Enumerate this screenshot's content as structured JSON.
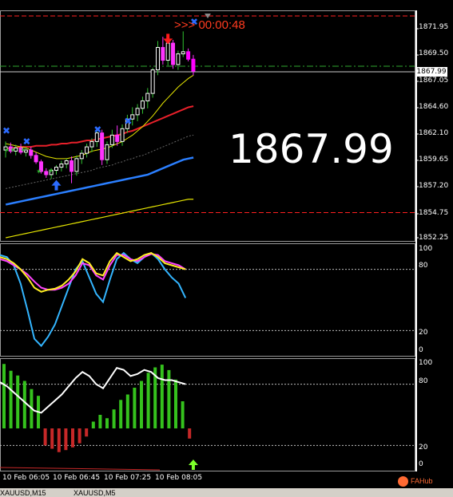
{
  "chart": {
    "symbol_tabs": [
      "XAUUSD,M15",
      "XAUUSD,M5"
    ],
    "current_price": "1867.99",
    "big_price": "1867.99",
    "countdown": ">>> 00:00:48",
    "price_axis": [
      "1871.95",
      "1869.50",
      "1867.05",
      "1864.60",
      "1862.10",
      "1859.65",
      "1857.20",
      "1854.75",
      "1852.25"
    ],
    "stoch_axis": [
      "100",
      "80",
      "20",
      "0"
    ],
    "osc_axis": [
      "100",
      "80",
      "20",
      "0"
    ],
    "time_axis": [
      "10 Feb 06:05",
      "10 Feb 06:45",
      "10 Feb 07:25",
      "10 Feb 08:05"
    ],
    "logo": "FAHub",
    "colors": {
      "bull_candle": "#ffffff",
      "bear_candle": "#ff00ff",
      "red_ma": "#e8202a",
      "blue_ma": "#2b7fff",
      "yellow_ma": "#e6e600",
      "stoch_main": "#ffee22",
      "stoch_signal": "#ff44ff",
      "stoch_cyan": "#33b5ff",
      "hist_pos": "#35c21d",
      "hist_neg": "#c62828",
      "countdown": "#ff3b1f"
    }
  },
  "chart_data": {
    "type": "line",
    "price_ylim": [
      1852.25,
      1871.95
    ],
    "last_price": 1867.99,
    "candles": [
      {
        "o": 1860.6,
        "h": 1861.4,
        "l": 1859.9,
        "c": 1860.9
      },
      {
        "o": 1860.9,
        "h": 1861.3,
        "l": 1860.3,
        "c": 1860.5
      },
      {
        "o": 1860.5,
        "h": 1861.1,
        "l": 1860.1,
        "c": 1860.8
      },
      {
        "o": 1860.8,
        "h": 1861.2,
        "l": 1860.2,
        "c": 1860.4
      },
      {
        "o": 1860.4,
        "h": 1860.9,
        "l": 1860.0,
        "c": 1860.6
      },
      {
        "o": 1860.6,
        "h": 1860.9,
        "l": 1859.8,
        "c": 1860.1
      },
      {
        "o": 1860.1,
        "h": 1860.4,
        "l": 1859.3,
        "c": 1859.5
      },
      {
        "o": 1859.5,
        "h": 1859.7,
        "l": 1858.4,
        "c": 1858.6
      },
      {
        "o": 1858.6,
        "h": 1858.9,
        "l": 1858.0,
        "c": 1858.3
      },
      {
        "o": 1858.3,
        "h": 1858.9,
        "l": 1857.9,
        "c": 1858.7
      },
      {
        "o": 1858.7,
        "h": 1859.2,
        "l": 1858.3,
        "c": 1859.0
      },
      {
        "o": 1859.0,
        "h": 1859.6,
        "l": 1858.6,
        "c": 1859.3
      },
      {
        "o": 1859.3,
        "h": 1859.8,
        "l": 1858.9,
        "c": 1859.6
      },
      {
        "o": 1859.6,
        "h": 1860.0,
        "l": 1857.5,
        "c": 1858.6
      },
      {
        "o": 1858.6,
        "h": 1860.1,
        "l": 1858.2,
        "c": 1859.8
      },
      {
        "o": 1859.8,
        "h": 1860.6,
        "l": 1859.3,
        "c": 1860.3
      },
      {
        "o": 1860.3,
        "h": 1861.2,
        "l": 1859.9,
        "c": 1860.9
      },
      {
        "o": 1860.9,
        "h": 1861.7,
        "l": 1860.4,
        "c": 1861.4
      },
      {
        "o": 1861.4,
        "h": 1862.6,
        "l": 1860.9,
        "c": 1862.2
      },
      {
        "o": 1862.2,
        "h": 1862.5,
        "l": 1859.2,
        "c": 1859.7
      },
      {
        "o": 1859.7,
        "h": 1861.4,
        "l": 1859.3,
        "c": 1861.1
      },
      {
        "o": 1861.1,
        "h": 1862.5,
        "l": 1860.8,
        "c": 1862.0
      },
      {
        "o": 1862.0,
        "h": 1862.9,
        "l": 1861.0,
        "c": 1861.4
      },
      {
        "o": 1861.4,
        "h": 1863.0,
        "l": 1861.0,
        "c": 1862.6
      },
      {
        "o": 1862.6,
        "h": 1863.9,
        "l": 1862.2,
        "c": 1863.5
      },
      {
        "o": 1863.5,
        "h": 1864.6,
        "l": 1862.9,
        "c": 1863.9
      },
      {
        "o": 1863.9,
        "h": 1864.9,
        "l": 1863.3,
        "c": 1864.5
      },
      {
        "o": 1864.5,
        "h": 1865.6,
        "l": 1864.0,
        "c": 1865.2
      },
      {
        "o": 1865.2,
        "h": 1866.4,
        "l": 1864.5,
        "c": 1865.9
      },
      {
        "o": 1865.9,
        "h": 1868.3,
        "l": 1865.5,
        "c": 1868.1
      },
      {
        "o": 1868.1,
        "h": 1870.8,
        "l": 1867.6,
        "c": 1870.2
      },
      {
        "o": 1870.2,
        "h": 1871.2,
        "l": 1868.6,
        "c": 1869.0
      },
      {
        "o": 1869.0,
        "h": 1871.0,
        "l": 1868.5,
        "c": 1870.6
      },
      {
        "o": 1870.6,
        "h": 1870.9,
        "l": 1868.2,
        "c": 1868.6
      },
      {
        "o": 1868.6,
        "h": 1869.9,
        "l": 1868.1,
        "c": 1869.6
      },
      {
        "o": 1869.6,
        "h": 1871.7,
        "l": 1869.3,
        "c": 1869.8
      },
      {
        "o": 1869.8,
        "h": 1870.1,
        "l": 1868.9,
        "c": 1869.1
      },
      {
        "o": 1869.1,
        "h": 1869.5,
        "l": 1867.6,
        "c": 1867.99
      }
    ],
    "red_ma": [
      1860.7,
      1860.8,
      1860.8,
      1860.9,
      1860.9,
      1860.9,
      1861.0,
      1861.0,
      1861.0,
      1861.1,
      1861.1,
      1861.2,
      1861.2,
      1861.3,
      1861.3,
      1861.4,
      1861.5,
      1861.5,
      1861.6,
      1861.7,
      1861.8,
      1861.9,
      1862.0,
      1862.1,
      1862.3,
      1862.4,
      1862.6,
      1862.8,
      1863.0,
      1863.2,
      1863.4,
      1863.6,
      1863.8,
      1864.0,
      1864.2,
      1864.4,
      1864.6,
      1864.7
    ],
    "yellow_ma": [
      1861.2,
      1861.1,
      1861.0,
      1860.9,
      1860.8,
      1860.6,
      1860.4,
      1860.2,
      1860.0,
      1859.9,
      1859.8,
      1859.8,
      1859.8,
      1859.9,
      1860.0,
      1860.1,
      1860.3,
      1860.5,
      1860.6,
      1860.7,
      1860.8,
      1861.0,
      1861.2,
      1861.4,
      1861.7,
      1862.0,
      1862.4,
      1862.8,
      1863.3,
      1863.8,
      1864.4,
      1865.0,
      1865.5,
      1866.0,
      1866.5,
      1866.9,
      1867.3,
      1867.6
    ],
    "gray_ma": [
      1857.0,
      1857.1,
      1857.2,
      1857.3,
      1857.4,
      1857.5,
      1857.6,
      1857.7,
      1857.8,
      1857.9,
      1858.0,
      1858.1,
      1858.2,
      1858.3,
      1858.4,
      1858.5,
      1858.6,
      1858.7,
      1858.9,
      1859.0,
      1859.1,
      1859.2,
      1859.4,
      1859.5,
      1859.7,
      1859.8,
      1860.0,
      1860.1,
      1860.3,
      1860.5,
      1860.7,
      1860.9,
      1861.1,
      1861.3,
      1861.5,
      1861.7,
      1861.9,
      1862.0
    ],
    "blue_ma": [
      1855.5,
      1855.6,
      1855.7,
      1855.8,
      1855.9,
      1856.0,
      1856.1,
      1856.2,
      1856.3,
      1856.4,
      1856.5,
      1856.6,
      1856.7,
      1856.8,
      1856.9,
      1857.0,
      1857.1,
      1857.2,
      1857.3,
      1857.4,
      1857.5,
      1857.6,
      1857.7,
      1857.8,
      1857.9,
      1858.0,
      1858.1,
      1858.2,
      1858.3,
      1858.5,
      1858.7,
      1858.9,
      1859.1,
      1859.3,
      1859.5,
      1859.7,
      1859.8,
      1859.9
    ],
    "yellow_low": [
      1852.4,
      1852.5,
      1852.6,
      1852.7,
      1852.8,
      1852.9,
      1853.0,
      1853.1,
      1853.2,
      1853.3,
      1853.4,
      1853.5,
      1853.6,
      1853.7,
      1853.8,
      1853.9,
      1854.0,
      1854.1,
      1854.2,
      1854.3,
      1854.4,
      1854.5,
      1854.6,
      1854.7,
      1854.8,
      1854.9,
      1855.0,
      1855.1,
      1855.2,
      1855.3,
      1855.4,
      1855.5,
      1855.6,
      1855.7,
      1855.8,
      1855.9,
      1856.0,
      1856.0
    ],
    "stoch_main": [
      92,
      90,
      86,
      80,
      72,
      62,
      58,
      60,
      61,
      64,
      70,
      78,
      90,
      86,
      76,
      74,
      88,
      96,
      92,
      88,
      90,
      94,
      96,
      92,
      86,
      84,
      82,
      80
    ],
    "stoch_signal": [
      90,
      88,
      84,
      80,
      75,
      68,
      62,
      60,
      60,
      62,
      66,
      74,
      86,
      84,
      74,
      70,
      84,
      94,
      94,
      90,
      88,
      92,
      95,
      94,
      88,
      86,
      84,
      80
    ],
    "stoch_cyan": [
      94,
      92,
      84,
      66,
      40,
      12,
      5,
      14,
      26,
      44,
      62,
      80,
      88,
      72,
      56,
      48,
      70,
      90,
      96,
      90,
      86,
      92,
      96,
      90,
      80,
      72,
      66,
      52
    ],
    "osc_line": [
      82,
      78,
      72,
      66,
      60,
      54,
      52,
      58,
      64,
      70,
      78,
      86,
      92,
      88,
      80,
      76,
      86,
      96,
      94,
      88,
      90,
      94,
      92,
      86,
      84,
      84,
      82,
      80
    ],
    "osc_hist": [
      95,
      85,
      78,
      70,
      58,
      48,
      -25,
      -30,
      -35,
      -32,
      -28,
      -22,
      -12,
      10,
      20,
      15,
      28,
      42,
      50,
      60,
      70,
      82,
      90,
      94,
      86,
      72,
      40,
      -15
    ],
    "hlines": {
      "upper_red": 1871.95,
      "lower_red": 1854.75,
      "green_dash": 1868.5,
      "current": 1867.99
    },
    "signals": [
      {
        "type": "sell_arrow",
        "color": "red",
        "x_index": 32,
        "price": 1871.4
      },
      {
        "type": "buy_arrow",
        "color": "blue",
        "x_index": 10,
        "price": 1857.8
      },
      {
        "type": "x_mark",
        "color": "blue",
        "x_index": 0,
        "price": 1862.4
      },
      {
        "type": "x_mark",
        "color": "blue",
        "x_index": 4,
        "price": 1861.4
      },
      {
        "type": "x_mark",
        "color": "blue",
        "x_index": 18,
        "price": 1862.5
      },
      {
        "type": "x_mark",
        "color": "blue",
        "x_index": 24,
        "price": 1863.3
      },
      {
        "type": "x_mark",
        "color": "blue",
        "x_index": 37,
        "price": 1872.6
      },
      {
        "type": "buy_arrow",
        "color": "green",
        "x_index": 37,
        "panel": "osc"
      }
    ]
  }
}
